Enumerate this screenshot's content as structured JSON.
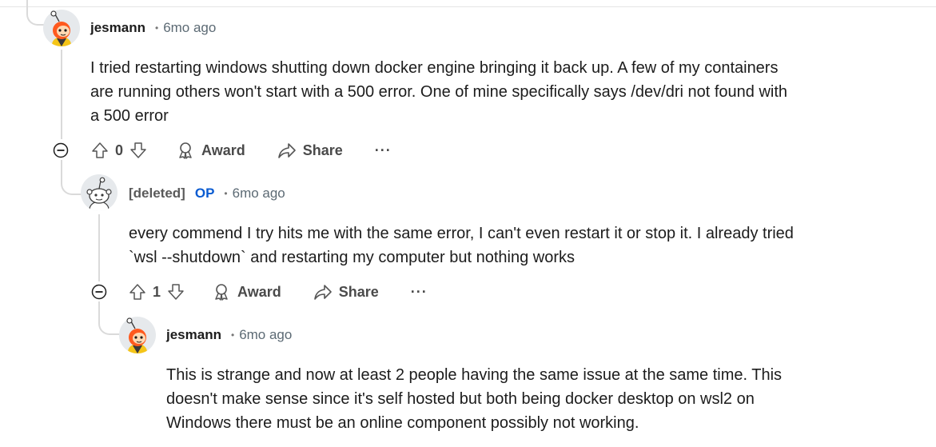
{
  "comments": [
    {
      "username": "jesmann",
      "is_op": false,
      "op_label": "",
      "timestamp": "6mo ago",
      "body": [
        "I tried restarting windows shutting down docker engine bringing it back up. A few of my containers",
        "are running others won't start with a 500 error. One of mine specifically says /dev/dri not found with",
        "a 500 error"
      ],
      "votes": "0",
      "award_label": "Award",
      "share_label": "Share",
      "more_label": "···"
    },
    {
      "username": "[deleted]",
      "is_op": true,
      "op_label": "OP",
      "timestamp": "6mo ago",
      "body": [
        "every commend I try hits me with the same error, I can't even restart it or stop it. I already tried",
        "`wsl --shutdown` and restarting my computer but nothing works"
      ],
      "votes": "1",
      "award_label": "Award",
      "share_label": "Share",
      "more_label": "···"
    },
    {
      "username": "jesmann",
      "is_op": false,
      "op_label": "",
      "timestamp": "6mo ago",
      "body": [
        "This is strange and now at least 2 people having the same issue at the same time. This",
        "doesn't make sense since it's self hosted but both being docker desktop on wsl2 on",
        "Windows there must be an online component possibly not working."
      ]
    }
  ],
  "separator": "•",
  "colors": {
    "op_badge": "#0a5bd1",
    "thread_line": "#dadada",
    "text": "#1c1c1c",
    "muted": "#5c6a74"
  },
  "icons": {
    "upvote": "upvote-arrow-icon",
    "downvote": "downvote-arrow-icon",
    "award": "award-icon",
    "share": "share-icon",
    "collapse": "collapse-minus-icon"
  }
}
